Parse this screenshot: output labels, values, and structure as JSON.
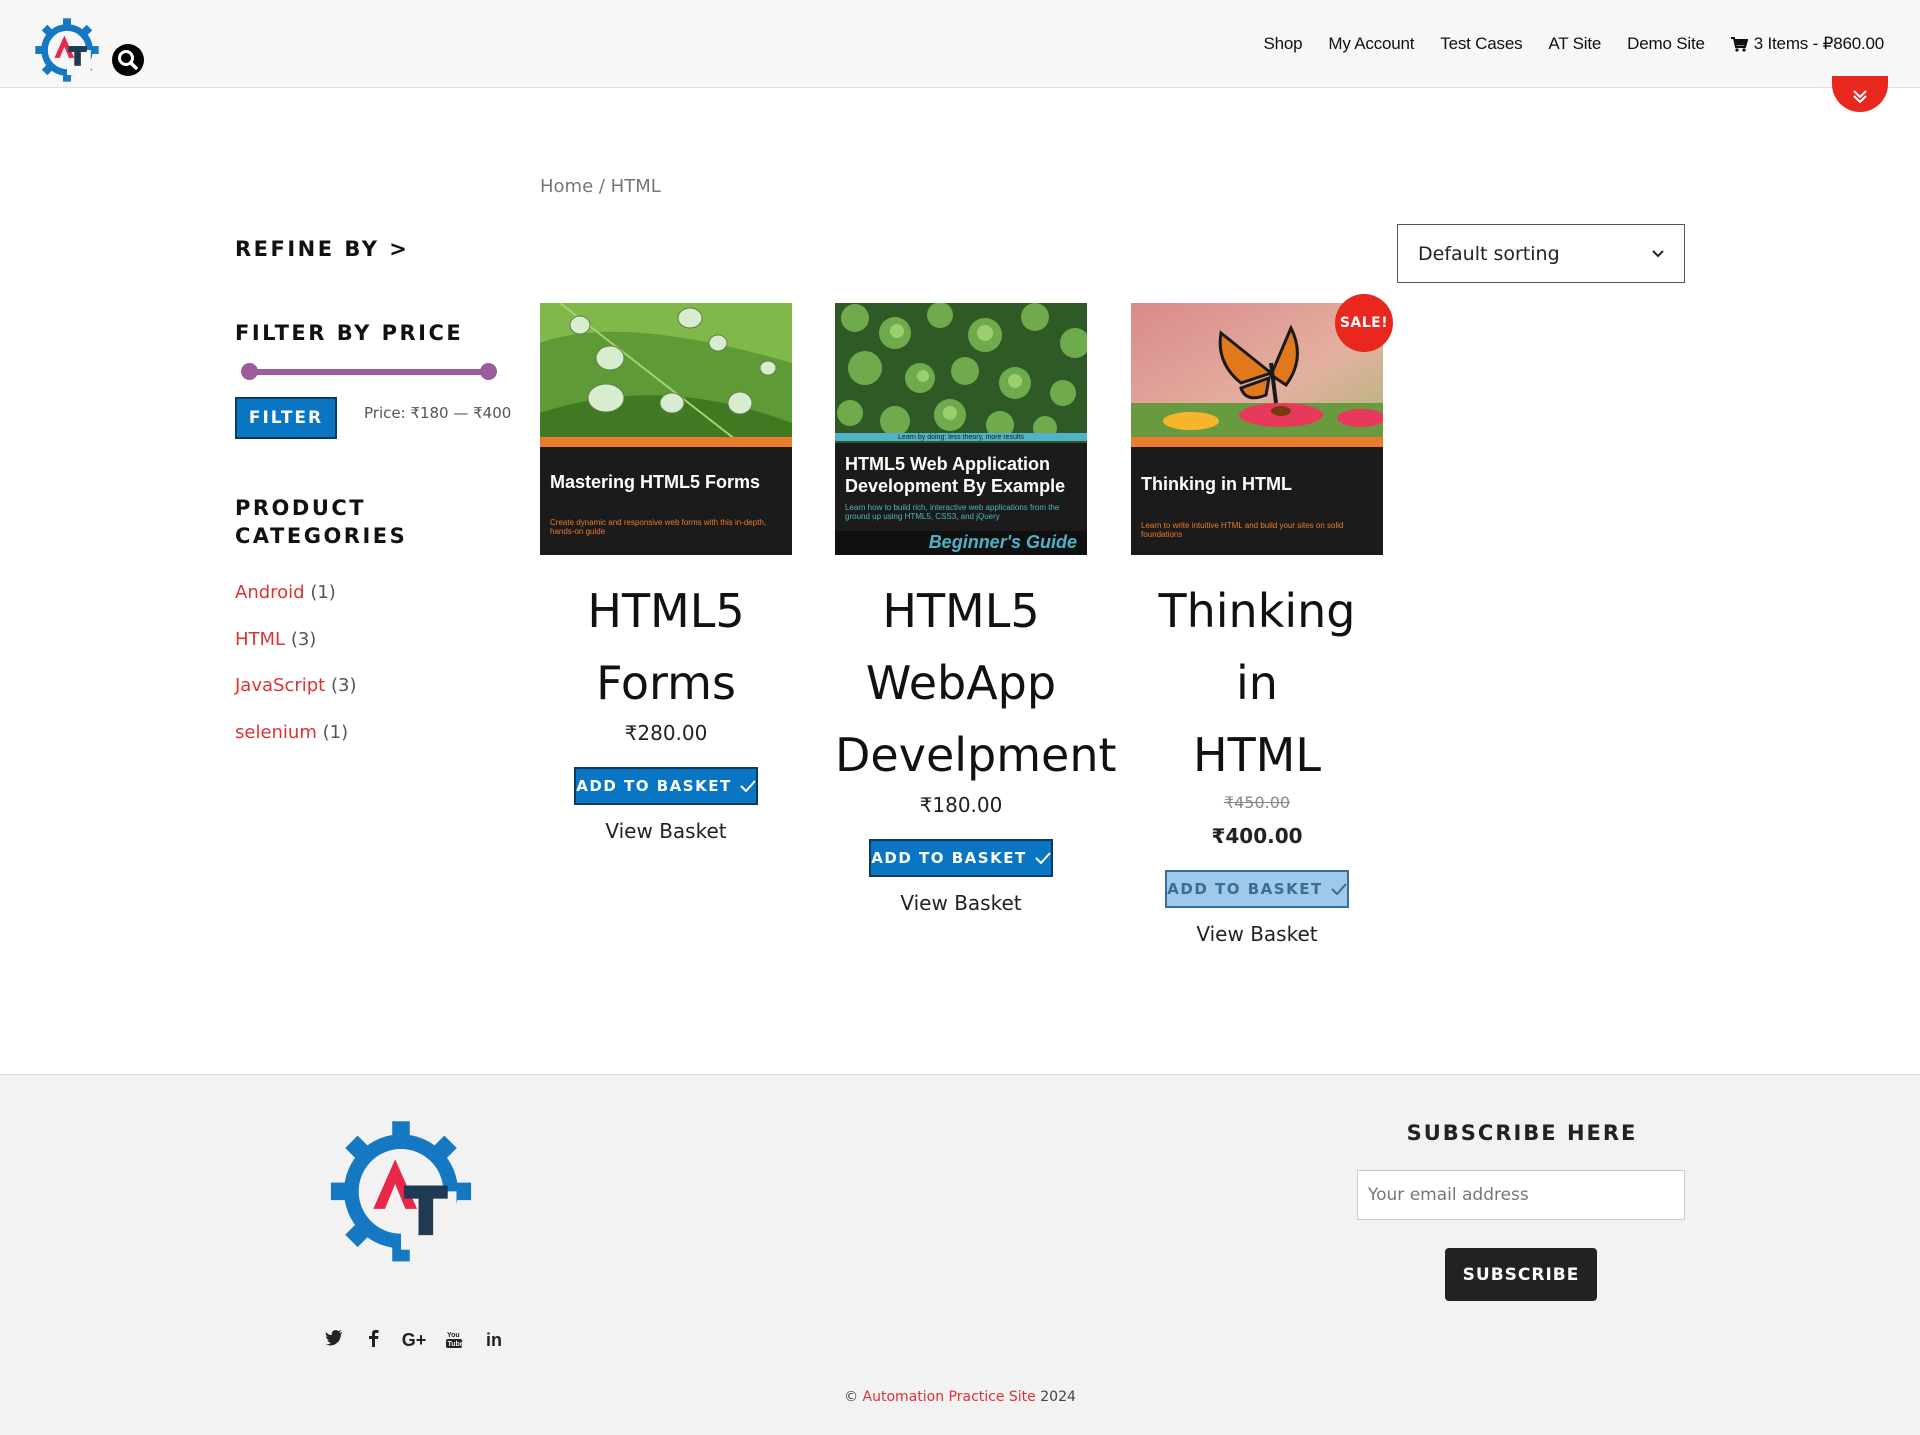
{
  "header": {
    "nav": [
      "Shop",
      "My Account",
      "Test Cases",
      "AT Site",
      "Demo Site"
    ],
    "cart_label": "3 Items - ₽860.00"
  },
  "breadcrumb": {
    "home": "Home",
    "separator": " / ",
    "current": "HTML"
  },
  "sorting": {
    "selected": "Default sorting"
  },
  "sidebar": {
    "refine_by": "REFINE BY >",
    "filter_title": "FILTER BY PRICE",
    "price_slider": {
      "min": 180,
      "max": 400
    },
    "filter_button": "FILTER",
    "price_range": "Price: ₹180 — ₹400",
    "categories_title_line1": "PRODUCT",
    "categories_title_line2": "CATEGORIES",
    "categories": [
      {
        "name": "Android",
        "count": "(1)"
      },
      {
        "name": "HTML",
        "count": "(3)"
      },
      {
        "name": "JavaScript",
        "count": "(3)"
      },
      {
        "name": "selenium",
        "count": "(1)"
      }
    ]
  },
  "products": [
    {
      "cover_title": "Mastering HTML5 Forms",
      "cover_subtitle": "Create dynamic and responsive web forms with this in-depth, hands-on guide",
      "title_lines": [
        "HTML5",
        "Forms"
      ],
      "price": "₹280.00",
      "add_button": "ADD TO BASKET",
      "view_basket": "View Basket"
    },
    {
      "cover_tagline": "Learn by doing: less theory, more results",
      "cover_title_line1": "HTML5 Web Application",
      "cover_title_line2": "Development By Example",
      "cover_subtitle": "Learn how to build rich, interactive web applications from the ground up using HTML5, CSS3, and jQuery",
      "cover_series": "Beginner's Guide",
      "title_lines": [
        "HTML5",
        "WebApp",
        "Develpment"
      ],
      "price": "₹180.00",
      "add_button": "ADD TO BASKET",
      "view_basket": "View Basket"
    },
    {
      "cover_title": "Thinking in HTML",
      "cover_subtitle": "Learn to write intuitive HTML and build your sites on solid foundations",
      "sale_badge": "SALE!",
      "title_lines": [
        "Thinking in",
        "HTML"
      ],
      "old_price": "₹450.00",
      "price": "₹400.00",
      "add_button": "ADD TO BASKET",
      "view_basket": "View Basket"
    }
  ],
  "footer": {
    "subscribe_title": "SUBSCRIBE HERE",
    "email_placeholder": "Your email address",
    "subscribe_button": "SUBSCRIBE",
    "copyright_symbol": "©",
    "copyright_link": "Automation Practice Site",
    "copyright_year": "2024",
    "socials": [
      "twitter-icon",
      "facebook-icon",
      "google-plus-icon",
      "youtube-icon",
      "linkedin-icon"
    ]
  },
  "colors": {
    "accent_blue": "#0a75c2",
    "link_red": "#dd3333",
    "slider_purple": "#9b5c9b",
    "sale_red": "#e8271e",
    "logo_blue": "#1578c2",
    "logo_red": "#e8274a",
    "logo_dark": "#1f3a52"
  }
}
